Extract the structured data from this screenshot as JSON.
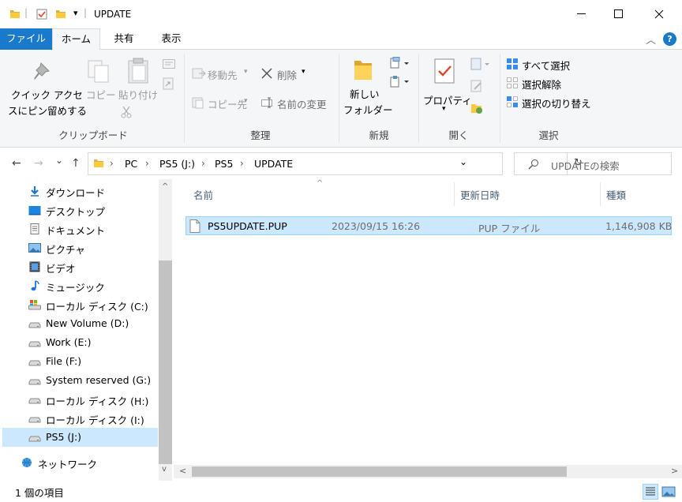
{
  "window": {
    "title": "UPDATE",
    "quick_access_separator": "|",
    "dropdown_glyph": "▾",
    "controls": {
      "minimize": "—",
      "maximize": "☐",
      "close": "✕"
    }
  },
  "ribbon_tabs": {
    "file": "ファイル",
    "home": "ホーム",
    "share": "共有",
    "view": "表示",
    "collapse_glyph": "︿",
    "help_glyph": "?"
  },
  "ribbon": {
    "clipboard": {
      "pin_line1": "クイック アクセ",
      "pin_line2": "スにピン留めする",
      "copy": "コピー",
      "paste": "貼り付け",
      "group": "クリップボード"
    },
    "organize": {
      "move_to": "移動先",
      "copy_to": "コピー先",
      "delete": "削除",
      "rename": "名前の変更",
      "group": "整理"
    },
    "new": {
      "new_folder_line1": "新しい",
      "new_folder_line2": "フォルダー",
      "group": "新規"
    },
    "open": {
      "properties": "プロパティ",
      "group": "開く"
    },
    "select": {
      "select_all": "すべて選択",
      "select_none": "選択解除",
      "invert_selection": "選択の切り替え",
      "group": "選択"
    }
  },
  "address": {
    "back": "←",
    "forward": "→",
    "recent": "⌄",
    "up": "↑",
    "separator": "›",
    "crumbs": [
      "PC",
      "PS5 (J:)",
      "PS5",
      "UPDATE"
    ],
    "dropdown": "⌄",
    "refresh": "↻",
    "search_placeholder": "UPDATEの検索"
  },
  "nav_pane": {
    "items": [
      {
        "label": "ダウンロード",
        "icon": "download-icon"
      },
      {
        "label": "デスクトップ",
        "icon": "desktop-icon"
      },
      {
        "label": "ドキュメント",
        "icon": "document-icon"
      },
      {
        "label": "ピクチャ",
        "icon": "pictures-icon"
      },
      {
        "label": "ビデオ",
        "icon": "video-icon"
      },
      {
        "label": "ミュージック",
        "icon": "music-icon"
      },
      {
        "label": "ローカル ディスク (C:)",
        "icon": "system-drive-icon"
      },
      {
        "label": "New Volume (D:)",
        "icon": "drive-icon"
      },
      {
        "label": "Work (E:)",
        "icon": "drive-icon"
      },
      {
        "label": "File (F:)",
        "icon": "drive-icon"
      },
      {
        "label": "System reserved (G:)",
        "icon": "drive-icon"
      },
      {
        "label": "ローカル ディスク (H:)",
        "icon": "drive-icon"
      },
      {
        "label": "ローカル ディスク (I:)",
        "icon": "drive-icon"
      },
      {
        "label": "PS5 (J:)",
        "icon": "drive-icon",
        "selected": true
      },
      {
        "label": "ネットワーク",
        "icon": "network-icon"
      }
    ],
    "scroll_up": "^",
    "scroll_down": "v"
  },
  "content": {
    "sort_glyph": "^",
    "columns": {
      "name": "名前",
      "modified": "更新日時",
      "type": "種類"
    },
    "files": [
      {
        "name": "PS5UPDATE.PUP",
        "modified": "2023/09/15 16:26",
        "type": "PUP ファイル",
        "size": "1,146,908 KB",
        "selected": true
      }
    ],
    "scroll_left": "<",
    "scroll_right": ">"
  },
  "status_bar": {
    "item_count": "1 個の項目"
  },
  "colors": {
    "accent": "#1979ca",
    "selection": "#cce8ff",
    "selection_border": "#99d1ff",
    "folder": "#ffc83d"
  }
}
